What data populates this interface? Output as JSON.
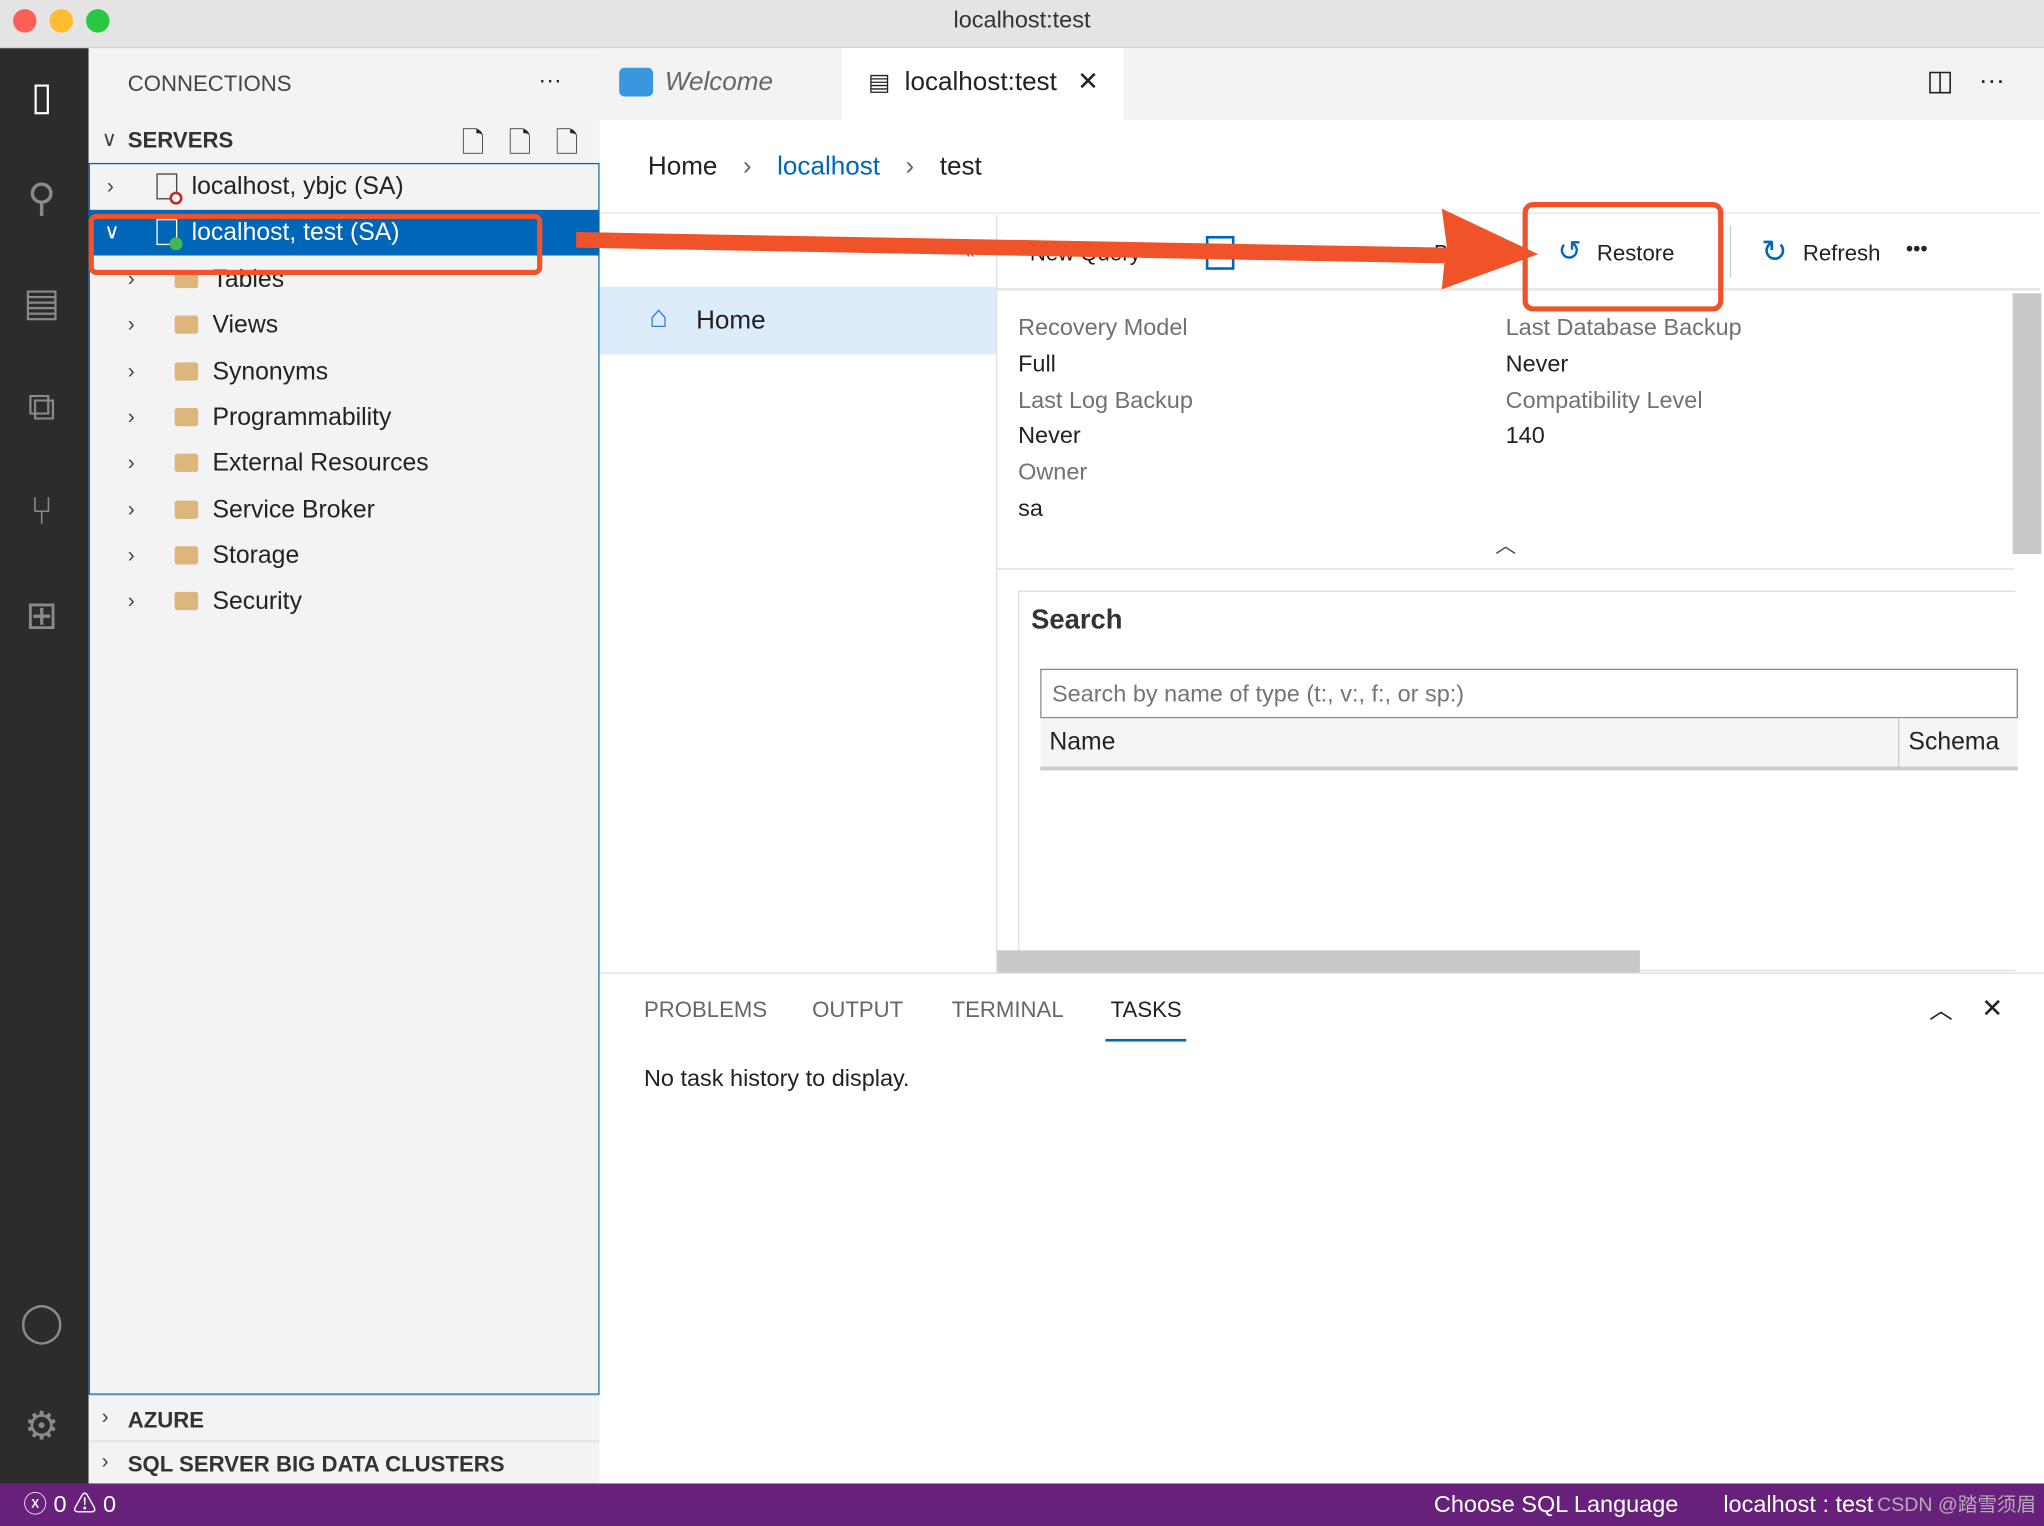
{
  "window": {
    "title": "localhost:test"
  },
  "activity_bar": {
    "items": [
      "connections-icon",
      "search-icon",
      "notebooks-icon",
      "explorer-icon",
      "source-control-icon",
      "extensions-icon"
    ],
    "bottom": [
      "account-icon",
      "gear-icon"
    ]
  },
  "sidebar": {
    "title": "CONNECTIONS",
    "more": "···",
    "servers_label": "SERVERS",
    "servers": [
      {
        "label": "localhost, ybjc (SA)",
        "status": "disconnected"
      },
      {
        "label": "localhost, test (SA)",
        "status": "connected",
        "selected": true
      }
    ],
    "folders": [
      "Tables",
      "Views",
      "Synonyms",
      "Programmability",
      "External Resources",
      "Service Broker",
      "Storage",
      "Security"
    ],
    "azure": "AZURE",
    "bdc": "SQL SERVER BIG DATA CLUSTERS"
  },
  "tabs": [
    {
      "label": "Welcome"
    },
    {
      "label": "localhost:test",
      "active": true,
      "close": "✕"
    }
  ],
  "breadcrumb": {
    "home": "Home",
    "server": "localhost",
    "db": "test"
  },
  "nav": {
    "home": "Home",
    "collapse": "«"
  },
  "toolbar": {
    "new_query": "New Query",
    "backup": "Backup",
    "restore": "Restore",
    "refresh": "Refresh",
    "more": "•••"
  },
  "properties": {
    "recovery_model_label": "Recovery Model",
    "recovery_model": "Full",
    "last_db_backup_label": "Last Database Backup",
    "last_db_backup": "Never",
    "last_log_backup_label": "Last Log Backup",
    "last_log_backup": "Never",
    "compat_label": "Compatibility Level",
    "compat": "140",
    "owner_label": "Owner",
    "owner": "sa"
  },
  "search": {
    "title": "Search",
    "placeholder": "Search by name of type (t:, v:, f:, or sp:)",
    "col_name": "Name",
    "col_schema": "Schema"
  },
  "panel": {
    "tabs": [
      "PROBLEMS",
      "OUTPUT",
      "TERMINAL",
      "TASKS"
    ],
    "active": "TASKS",
    "message": "No task history to display."
  },
  "statusbar": {
    "errors": "0",
    "warnings": "0",
    "language": "Choose SQL Language",
    "connection": "localhost : test",
    "watermark": "CSDN @踏雪须眉"
  },
  "colors": {
    "accent": "#0066b8",
    "status": "#68217a",
    "annotation": "#f0522a"
  }
}
